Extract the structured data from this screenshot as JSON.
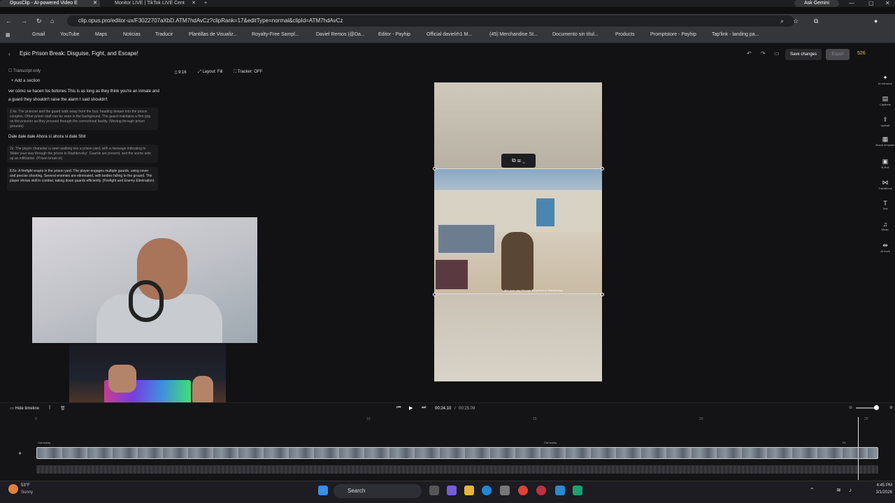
{
  "browser": {
    "tabs": [
      {
        "label": "OpusClip - AI-powered Video E"
      },
      {
        "label": "Monitor LIVE | TikTok LIVE Cent"
      }
    ],
    "gemini": "Ask Gemini",
    "url": "clip.opus.pro/editor-ux/F3022707aXbD.ATM7hdAvCz?clipRank=17&editType=normal&clipId=ATM7hdAvCz",
    "bookmarks": [
      "Gmail",
      "YouTube",
      "Maps",
      "Noticias",
      "Traducir",
      "Plantillas de Visualiz...",
      "Royalty-Free Sampl...",
      "Daviel Remos (@Da...",
      "Editor - Payhip",
      "Official davielrh1 M...",
      "(45) Merchandise St...",
      "Documento sin títul...",
      "Products",
      "Promptstore - Payhip",
      "Tap'link - landing pa..."
    ]
  },
  "editor": {
    "title": "Epic Prison Break: Disguise, Fight, and Escape!",
    "save_label": "Save changes",
    "export_label": "Export",
    "credits": "526",
    "transcript_only": "Transcript only",
    "add_section": "Add a section",
    "transcript_1": "ver cómo se hacen los botones This is as long as they think you're an inmate and a guard they shouldn't raise the alarm I said shouldn't",
    "note_1": "2.4s: The prisoner and the guard walk away from the bus, heading deeper into the prison complex. Other prison staff can be seen in the background. The guard maintains a firm grip on the prisoner as they proceed through the correctional facility. (Moving through prison grounds)",
    "transcript_2": "Dale dale dale Ahora sí ahora sí dale Shit",
    "note_2": "2s: The player character is seen walking into a prison yard, with a message indicating to 'Make your way through the prison to Rashkovsky'. Guards are present, and the scene sets up an infiltration. (Prison break-in)",
    "note_3": "8.6s: A firefight erupts in the prison yard. The player engages multiple guards, using cover and precise shooting. Several enemies are eliminated, with bodies falling to the ground. The player shows skill in combat, taking down guards efficiently. (Firefight and Enemy Elimination)",
    "ratio": "9:16",
    "layout": "Layout: Fill",
    "tracker": "Tracker: OFF",
    "caption_overlay": "ake your way through the prison to Rashkovsky",
    "right_tools": [
      "AI enhance",
      "Captions",
      "Upload",
      "Brand template",
      "B-Roll",
      "Transitions",
      "Text",
      "Music",
      "AI hook"
    ],
    "hide_timeline": "Hide timeline",
    "time_current": "00:24.10",
    "time_total": "00:25.09",
    "ruler_marks": [
      "0",
      "10",
      "15",
      "20",
      "25"
    ],
    "track_label_1": "Gameplay",
    "track_label_2": "Gameplay",
    "track_label_3": "Fit"
  },
  "taskbar": {
    "weather_temp": "53°F",
    "weather_desc": "Sunny",
    "search": "Search",
    "time": "4:45 PM",
    "date": "3/1/2026"
  }
}
